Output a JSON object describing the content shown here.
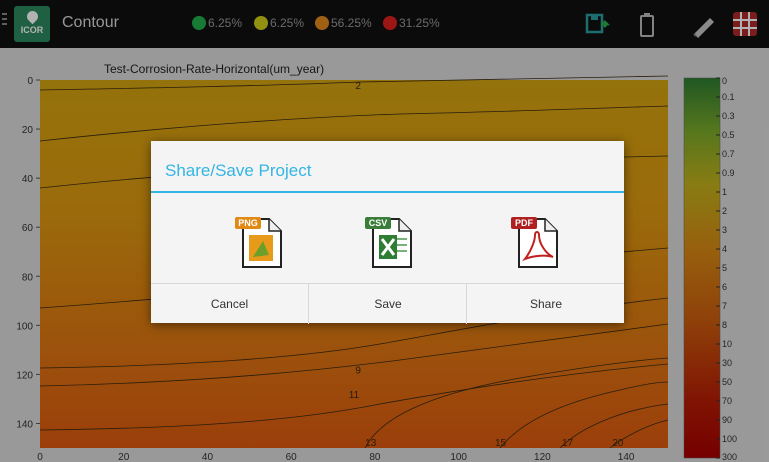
{
  "topbar": {
    "title": "Contour",
    "app_icon_label": "ICOR",
    "legend": [
      {
        "color": "#22b14c",
        "pct": "6.25%"
      },
      {
        "color": "#d2cf17",
        "pct": "6.25%"
      },
      {
        "color": "#e68a1c",
        "pct": "56.25%"
      },
      {
        "color": "#e02020",
        "pct": "31.25%"
      }
    ],
    "icons": [
      "share-save-icon",
      "battery-icon",
      "ruler-pen-icon",
      "grid-icon"
    ]
  },
  "chart_data": {
    "type": "heatmap",
    "title": "Test-Corrosion-Rate-Horizontal(um_year)",
    "x_ticks": [
      "0",
      "20",
      "40",
      "60",
      "80",
      "100",
      "120",
      "140"
    ],
    "y_ticks": [
      "0",
      "20",
      "40",
      "60",
      "80",
      "100",
      "120",
      "140"
    ],
    "xlim": [
      0,
      150
    ],
    "ylim": [
      0,
      150
    ],
    "contour_labels": [
      {
        "text": "2",
        "x": 76,
        "y": 2
      },
      {
        "text": "9",
        "x": 76,
        "y": 118
      },
      {
        "text": "11",
        "x": 75,
        "y": 128
      },
      {
        "text": "13",
        "x": 79,
        "y": 149
      },
      {
        "text": "15",
        "x": 110,
        "y": 149
      },
      {
        "text": "17",
        "x": 126,
        "y": 149
      },
      {
        "text": "20",
        "x": 138,
        "y": 149
      }
    ],
    "colorbar": {
      "ticks": [
        "0",
        "0.1",
        "0.3",
        "0.5",
        "0.7",
        "0.9",
        "1",
        "2",
        "3",
        "4",
        "5",
        "6",
        "7",
        "8",
        "10",
        "30",
        "50",
        "70",
        "90",
        "100",
        "300"
      ],
      "colors": [
        "#2e7d32",
        "#7cab2a",
        "#c4b21c",
        "#d98a14",
        "#cc5a0e",
        "#b81d05",
        "#a80000"
      ]
    }
  },
  "dialog": {
    "title": "Share/Save Project",
    "files": [
      {
        "label": "PNG",
        "badge_color": "#e08a14"
      },
      {
        "label": "CSV",
        "badge_color": "#3a7d3a"
      },
      {
        "label": "PDF",
        "badge_color": "#b02020"
      }
    ],
    "actions": {
      "cancel": "Cancel",
      "save": "Save",
      "share": "Share"
    }
  }
}
